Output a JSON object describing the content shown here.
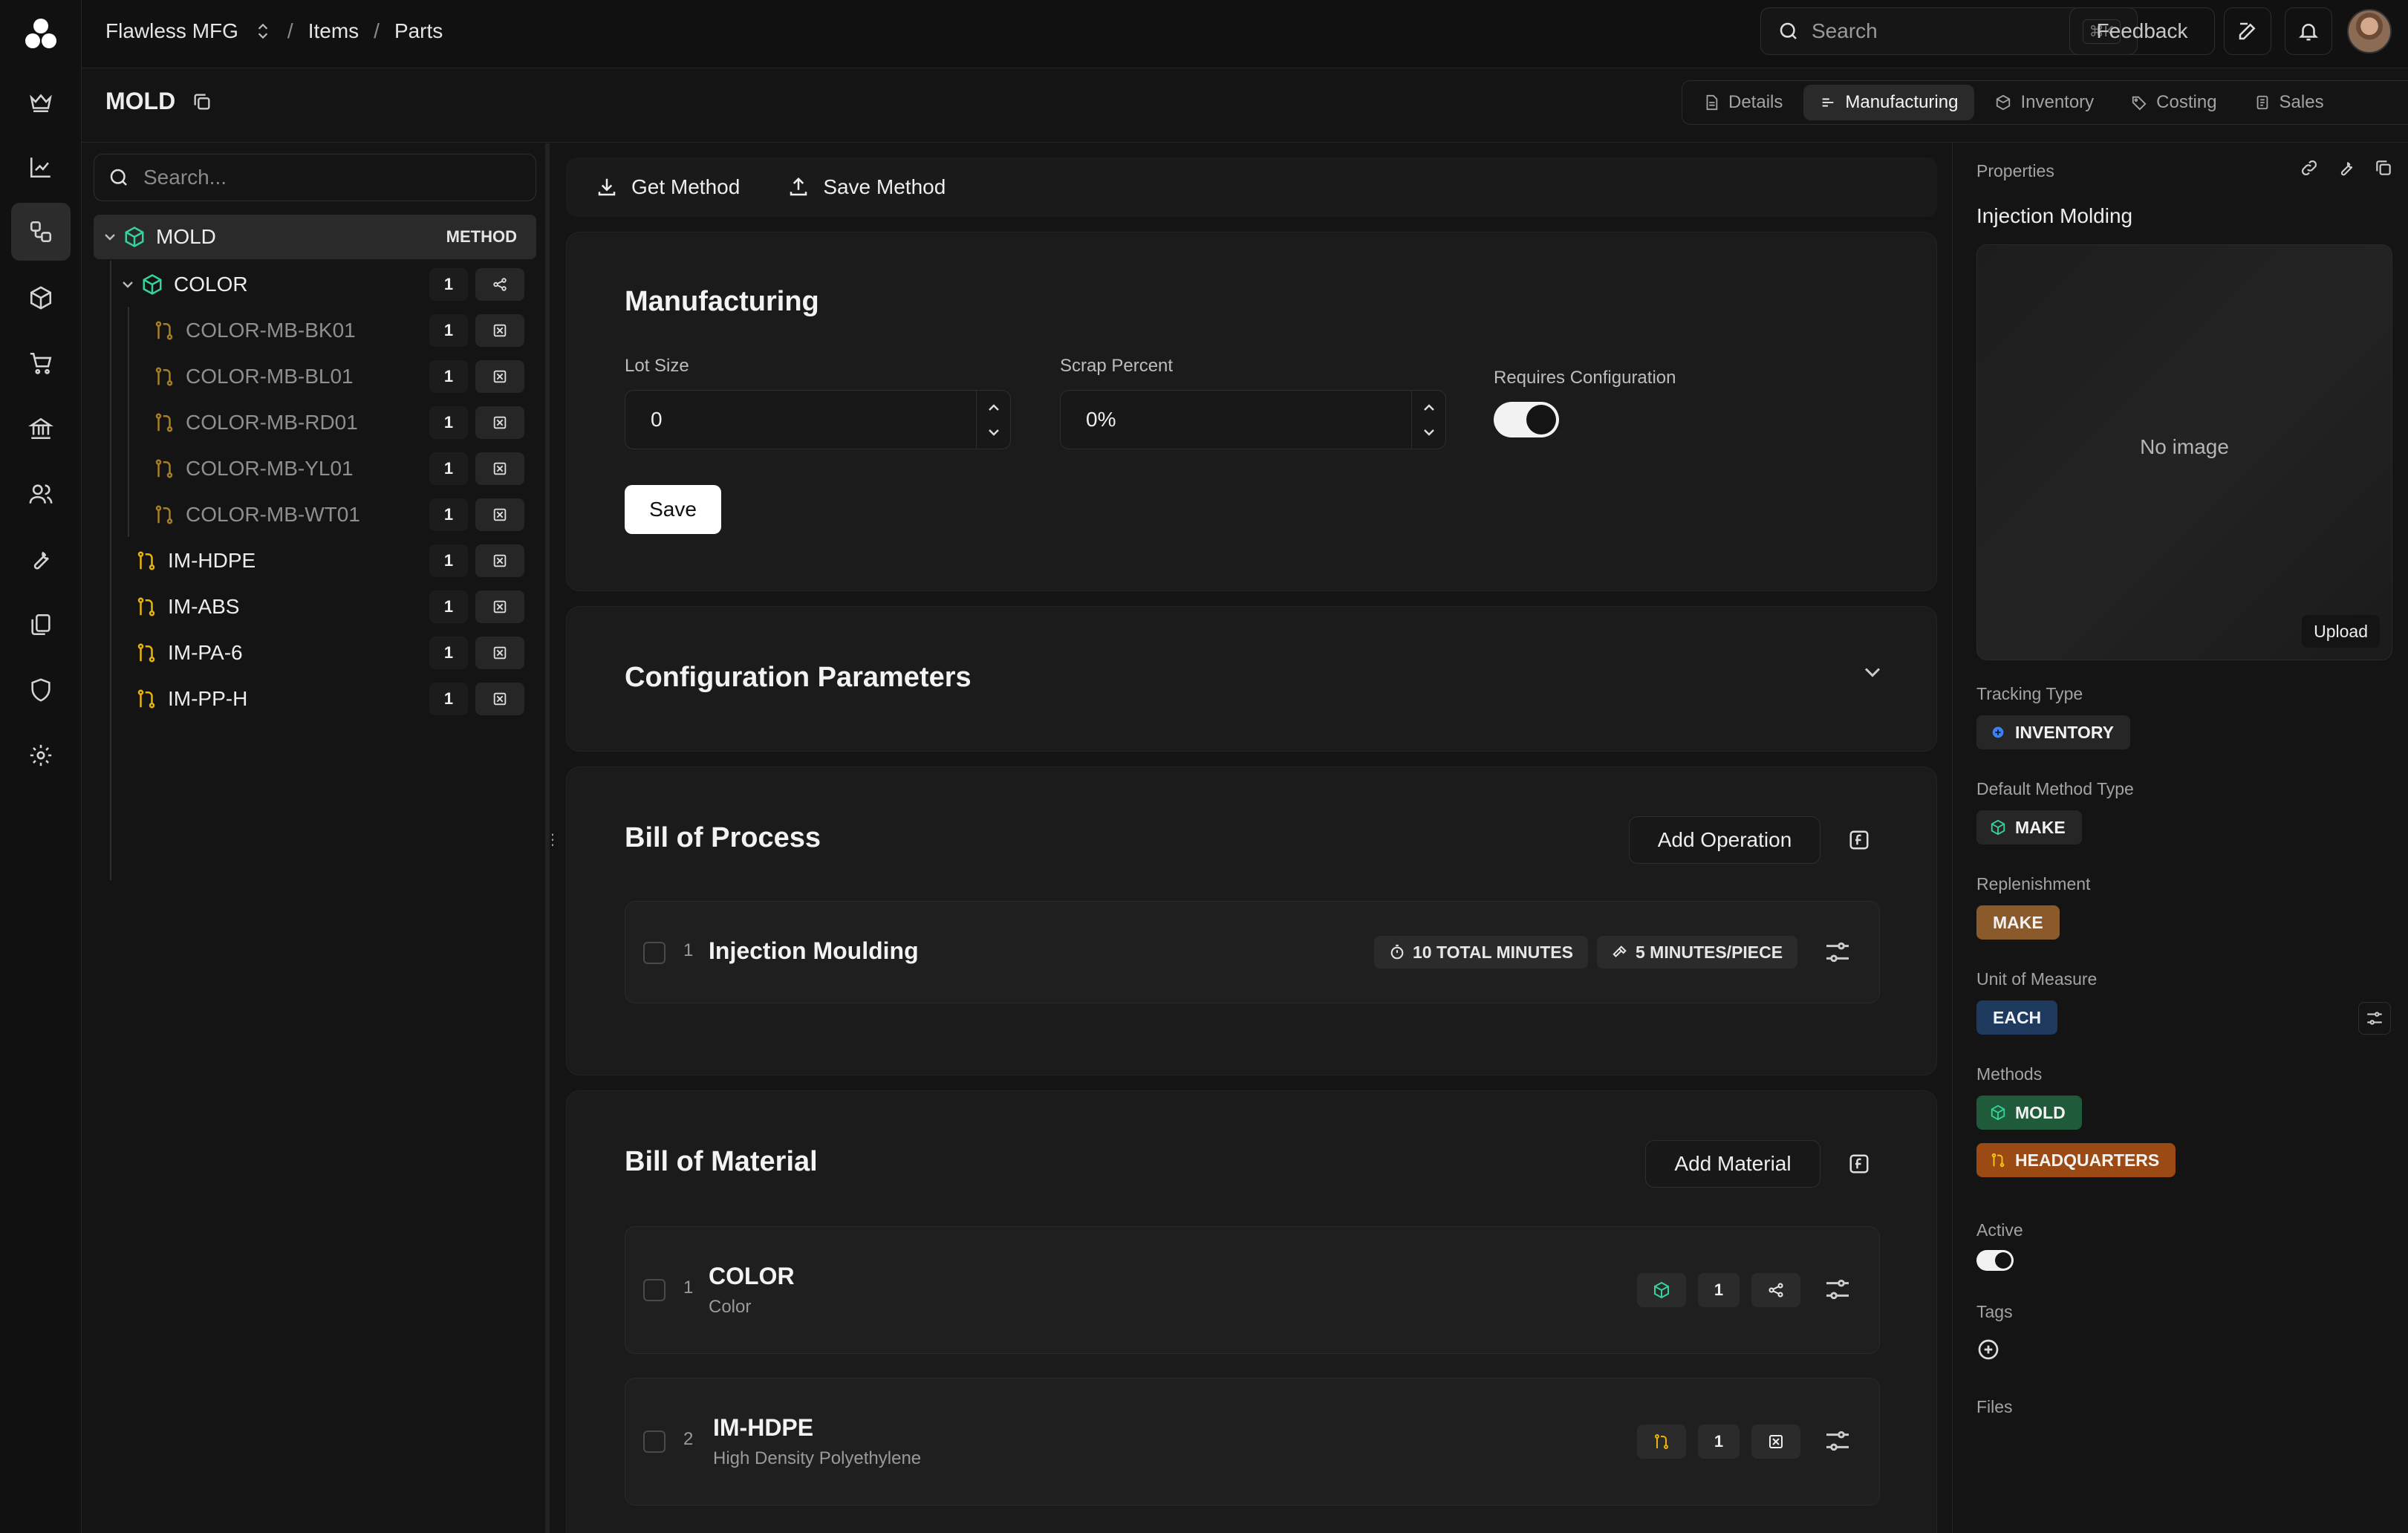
{
  "header": {
    "company": "Flawless MFG",
    "crumb_items": "Items",
    "crumb_parts": "Parts",
    "search_label": "Search",
    "search_shortcut": "⌘K",
    "feedback_label": "Feedback"
  },
  "page": {
    "title": "MOLD",
    "tabs": [
      {
        "label": "Details",
        "active": false
      },
      {
        "label": "Manufacturing",
        "active": true
      },
      {
        "label": "Inventory",
        "active": false
      },
      {
        "label": "Costing",
        "active": false
      },
      {
        "label": "Sales",
        "active": false
      }
    ]
  },
  "tree": {
    "search_placeholder": "Search...",
    "root": {
      "label": "MOLD",
      "badge": "METHOD"
    },
    "color_group": {
      "label": "COLOR",
      "qty": "1"
    },
    "color_items": [
      {
        "label": "COLOR-MB-BK01",
        "qty": "1"
      },
      {
        "label": "COLOR-MB-BL01",
        "qty": "1"
      },
      {
        "label": "COLOR-MB-RD01",
        "qty": "1"
      },
      {
        "label": "COLOR-MB-YL01",
        "qty": "1"
      },
      {
        "label": "COLOR-MB-WT01",
        "qty": "1"
      }
    ],
    "materials": [
      {
        "label": "IM-HDPE",
        "qty": "1"
      },
      {
        "label": "IM-ABS",
        "qty": "1"
      },
      {
        "label": "IM-PA-6",
        "qty": "1"
      },
      {
        "label": "IM-PP-H",
        "qty": "1"
      }
    ]
  },
  "toolbar": {
    "get_method": "Get Method",
    "save_method": "Save Method"
  },
  "manufacturing": {
    "title": "Manufacturing",
    "lot_size_label": "Lot Size",
    "lot_size_value": "0",
    "scrap_label": "Scrap Percent",
    "scrap_value": "0%",
    "requires_config_label": "Requires Configuration",
    "requires_config_on": true,
    "save_label": "Save"
  },
  "config_params": {
    "title": "Configuration Parameters"
  },
  "bill_of_process": {
    "title": "Bill of Process",
    "add_label": "Add Operation",
    "operations": [
      {
        "index": "1",
        "name": "Injection Moulding",
        "total": "10 TOTAL MINUTES",
        "per_piece": "5 MINUTES/PIECE"
      }
    ]
  },
  "bill_of_material": {
    "title": "Bill of Material",
    "add_label": "Add Material",
    "items": [
      {
        "index": "1",
        "name": "COLOR",
        "desc": "Color",
        "qty": "1"
      },
      {
        "index": "2",
        "name": "IM-HDPE",
        "desc": "High Density Polyethylene",
        "qty": "1"
      }
    ]
  },
  "properties": {
    "heading": "Properties",
    "name": "Injection Molding",
    "no_image": "No image",
    "upload": "Upload",
    "tracking_type_label": "Tracking Type",
    "tracking_type": "INVENTORY",
    "default_method_label": "Default Method Type",
    "default_method": "MAKE",
    "replenishment_label": "Replenishment",
    "replenishment": "MAKE",
    "uom_label": "Unit of Measure",
    "uom": "EACH",
    "methods_label": "Methods",
    "methods": [
      "MOLD",
      "HEADQUARTERS"
    ],
    "active_label": "Active",
    "active_on": true,
    "tags_label": "Tags",
    "files_label": "Files"
  },
  "colors": {
    "make_green": "#34d399",
    "pick_yellow": "#eab308",
    "replenish_brown": "#8a5a2b",
    "uom_blue": "#1e3a5f",
    "mold_green": "#1f5a3a",
    "hq_orange": "#9a4a12"
  }
}
